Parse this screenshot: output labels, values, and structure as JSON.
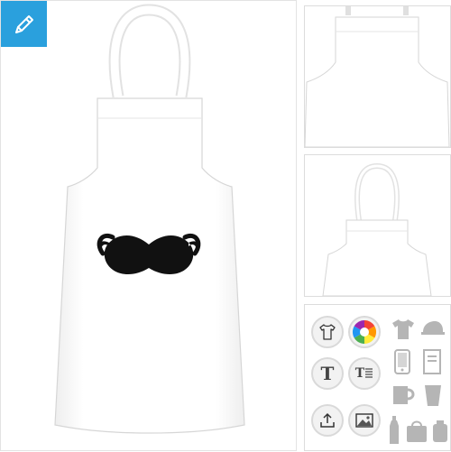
{
  "colors": {
    "accent": "#2aa0dd",
    "product": "#ffffff",
    "design": "#111111",
    "icon_gray": "#b5b5b5"
  },
  "main": {
    "edit_icon": "pencil-icon",
    "product": "apron",
    "design": "mustache"
  },
  "thumbnails": [
    {
      "view": "apron-closeup"
    },
    {
      "view": "apron-full"
    }
  ],
  "toolbar": {
    "tools": [
      {
        "icon": "tshirt-icon"
      },
      {
        "icon": "color-wheel-icon"
      },
      {
        "icon": "text-icon",
        "glyph": "T"
      },
      {
        "icon": "text-block-icon",
        "glyph": "T"
      },
      {
        "icon": "upload-icon"
      },
      {
        "icon": "image-icon"
      }
    ],
    "categories": [
      "tshirt-category-icon",
      "cap-icon",
      "phone-case-icon",
      "notebook-icon",
      "mug-icon",
      "cup-icon",
      "bottle-icon",
      "bag-icon",
      "more-icon"
    ]
  }
}
